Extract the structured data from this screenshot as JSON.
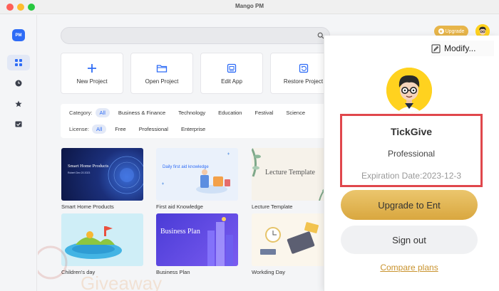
{
  "window": {
    "title": "Mango PM"
  },
  "sidebar": {
    "logo_text": "PM",
    "items": [
      {
        "icon": "grid-icon",
        "active": true
      },
      {
        "icon": "clock-icon",
        "active": false
      },
      {
        "icon": "star-icon",
        "active": false
      },
      {
        "icon": "checklist-icon",
        "active": false
      }
    ]
  },
  "header": {
    "search_placeholder": "",
    "upgrade_label": "Upgrade"
  },
  "actions": [
    {
      "label": "New Project",
      "icon": "plus-icon"
    },
    {
      "label": "Open Project",
      "icon": "folder-icon"
    },
    {
      "label": "Edit App",
      "icon": "app-icon"
    },
    {
      "label": "Restore Project",
      "icon": "restore-icon"
    }
  ],
  "filters": {
    "category_label": "Category:",
    "categories": [
      "All",
      "Business & Finance",
      "Technology",
      "Education",
      "Festival",
      "Science"
    ],
    "license_label": "License:",
    "licenses": [
      "All",
      "Free",
      "Professional",
      "Enterprise"
    ],
    "selected_category": "All",
    "selected_license": "All"
  },
  "templates": [
    {
      "caption": "Smart Home Products",
      "thumb_title": "Smart Home Products",
      "thumb_sub": "Robert Dev 20 2023"
    },
    {
      "caption": "First aid Knowledge",
      "thumb_title": "Daily first aid knowledge"
    },
    {
      "caption": "Lecture Template",
      "thumb_title": "Lecture Template"
    },
    {
      "caption": "Children's day",
      "thumb_title": ""
    },
    {
      "caption": "Business Plan",
      "thumb_title": "Business Plan"
    },
    {
      "caption": "Workding Day",
      "thumb_title": ""
    }
  ],
  "account_panel": {
    "modify_label": "Modify...",
    "username": "TickGive",
    "plan": "Professional",
    "expiration": "Expiration Date:2023-12-3",
    "upgrade_button": "Upgrade to Ent",
    "signout_button": "Sign out",
    "compare_link": "Compare plans"
  },
  "watermark": {
    "text": "Giveaway"
  },
  "colors": {
    "accent": "#2e6cf6",
    "gold": "#e7b54a",
    "highlight_box": "#e0474c"
  }
}
